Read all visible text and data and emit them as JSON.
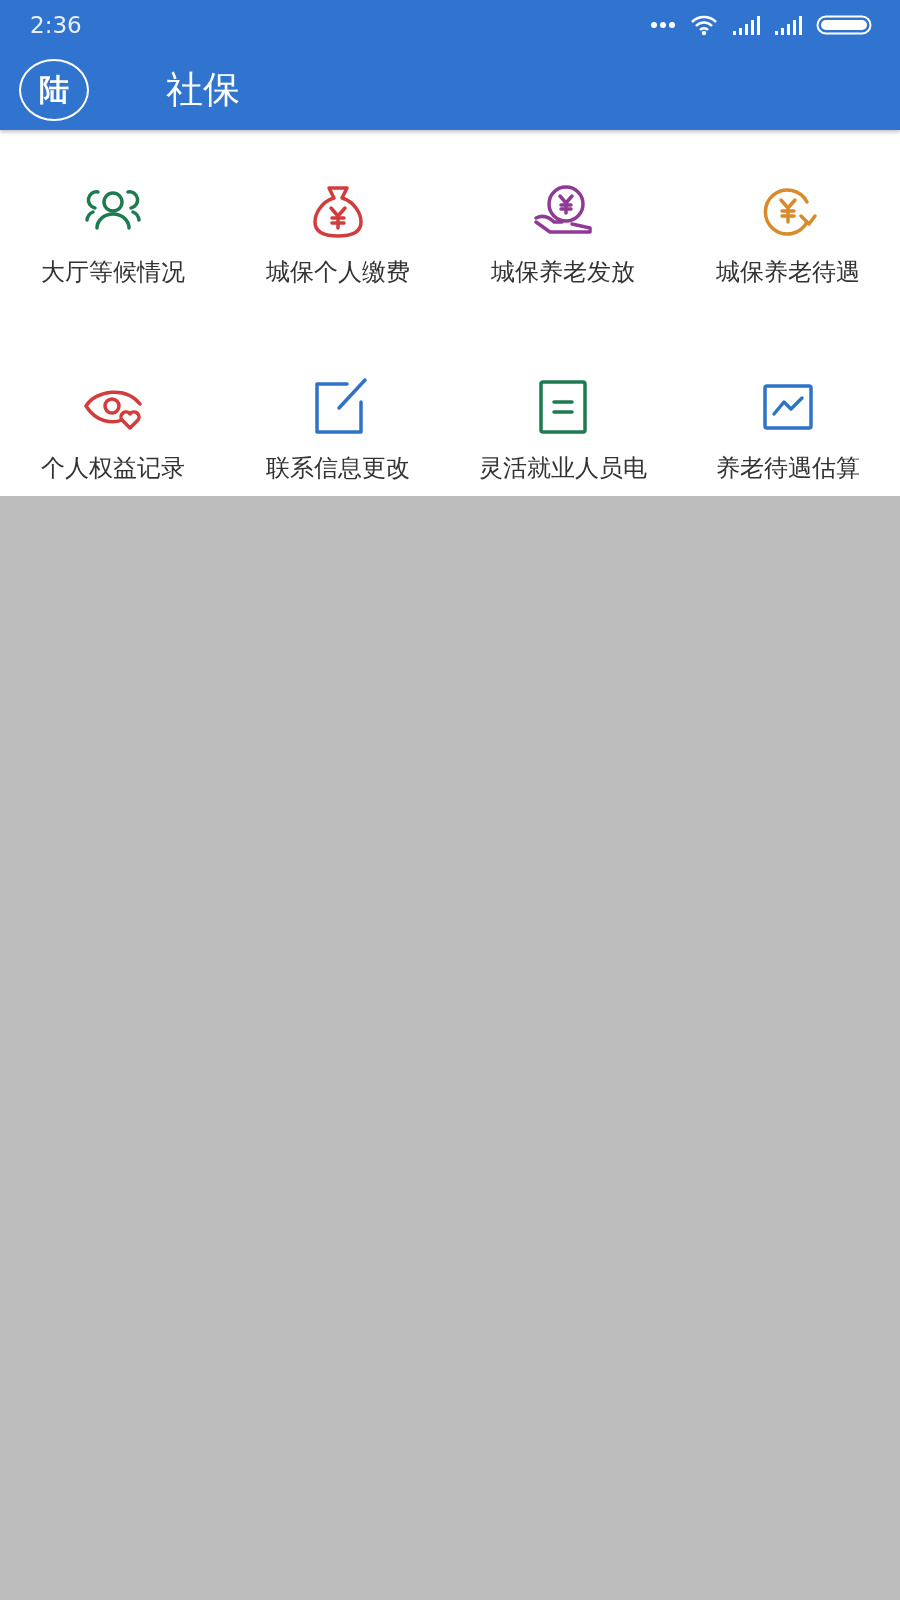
{
  "status_bar": {
    "time": "2:36"
  },
  "app_bar": {
    "avatar": "陆",
    "title": "社保"
  },
  "grid": [
    {
      "label": "大厅等候情况",
      "kind": "people",
      "color": "#1e7a4f"
    },
    {
      "label": "城保个人缴费",
      "kind": "moneybag",
      "color": "#d23c3c"
    },
    {
      "label": "城保养老发放",
      "kind": "handcoin",
      "color": "#8e3a96"
    },
    {
      "label": "城保养老待遇",
      "kind": "cyclecoin",
      "color": "#d98a2b"
    },
    {
      "label": "个人权益记录",
      "kind": "eyeheart",
      "color": "#d23c3c"
    },
    {
      "label": "联系信息更改",
      "kind": "edit",
      "color": "#2f73c9"
    },
    {
      "label": "灵活就业人员电",
      "kind": "doc",
      "color": "#1e7a4f"
    },
    {
      "label": "养老待遇估算",
      "kind": "chart",
      "color": "#2f73c9"
    }
  ]
}
